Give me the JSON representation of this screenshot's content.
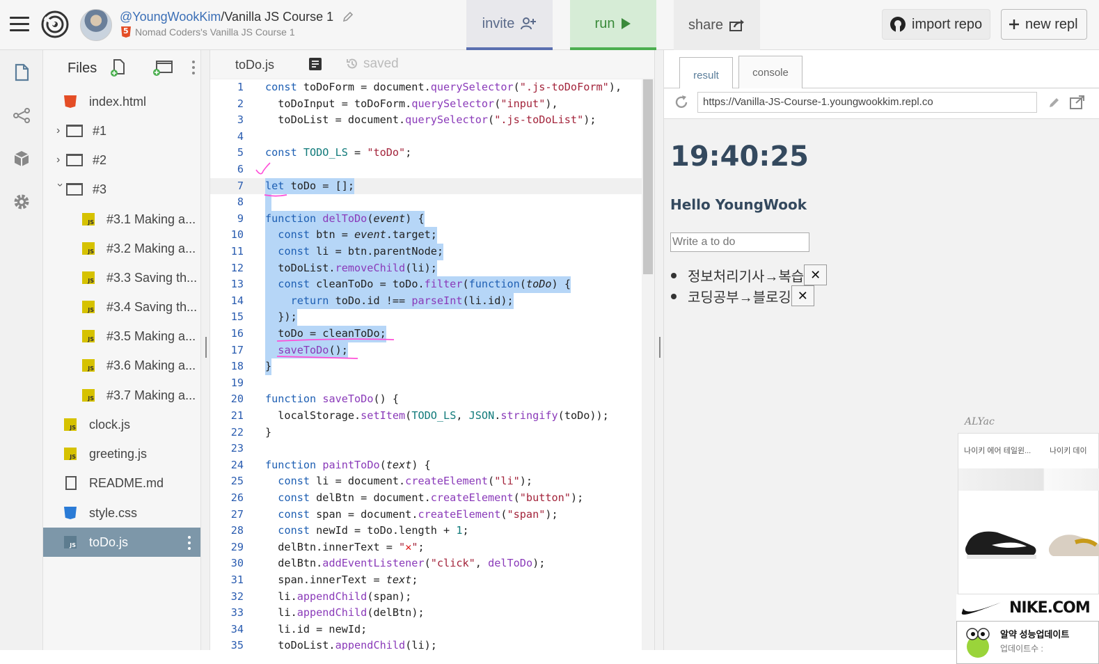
{
  "topbar": {
    "user": "@YoungWookKim",
    "separator": "/",
    "repl_name": "Vanilla JS Course 1",
    "subtitle": "Nomad Coders's Vanilla JS Course 1",
    "invite_label": "invite",
    "run_label": "run",
    "share_label": "share",
    "import_label": "import repo",
    "new_repl_label": "new repl",
    "accent_invite": "#5a6fb0",
    "accent_run": "#4caf50"
  },
  "files": {
    "title": "Files",
    "items": [
      {
        "label": "index.html",
        "icon": "html-file-icon"
      },
      {
        "label": "#1",
        "icon": "folder-icon"
      },
      {
        "label": "#2",
        "icon": "folder-icon"
      },
      {
        "label": "#3",
        "icon": "folder-icon"
      },
      {
        "label": "#3.1 Making a...",
        "icon": "js-file-icon"
      },
      {
        "label": "#3.2 Making a...",
        "icon": "js-file-icon"
      },
      {
        "label": "#3.3 Saving th...",
        "icon": "js-file-icon"
      },
      {
        "label": "#3.4 Saving th...",
        "icon": "js-file-icon"
      },
      {
        "label": "#3.5 Making a...",
        "icon": "js-file-icon"
      },
      {
        "label": "#3.6 Making a...",
        "icon": "js-file-icon"
      },
      {
        "label": "#3.7 Making a...",
        "icon": "js-file-icon"
      },
      {
        "label": "clock.js",
        "icon": "js-file-icon"
      },
      {
        "label": "greeting.js",
        "icon": "js-file-icon"
      },
      {
        "label": "README.md",
        "icon": "doc-file-icon"
      },
      {
        "label": "style.css",
        "icon": "css-file-icon"
      },
      {
        "label": "toDo.js",
        "icon": "js-file-icon",
        "selected": true
      }
    ]
  },
  "editor": {
    "tab_label": "toDo.js",
    "status": "saved",
    "lines": [
      "const toDoForm = document.querySelector(\".js-toDoForm\"),",
      "  toDoInput = toDoForm.querySelector(\"input\"),",
      "  toDoList = document.querySelector(\".js-toDoList\");",
      "",
      "const TODO_LS = \"toDo\";",
      "",
      "let toDo = [];",
      "",
      "function delToDo(event) {",
      "  const btn = event.target;",
      "  const li = btn.parentNode;",
      "  toDoList.removeChild(li);",
      "  const cleanToDo = toDo.filter(function(toDo) {",
      "    return toDo.id !== parseInt(li.id);",
      "  });",
      "  toDo = cleanToDo;",
      "  saveToDo();",
      "}",
      "",
      "function saveToDo() {",
      "  localStorage.setItem(TODO_LS, JSON.stringify(toDo));",
      "}",
      "",
      "function paintToDo(text) {",
      "  const li = document.createElement(\"li\");",
      "  const delBtn = document.createElement(\"button\");",
      "  const span = document.createElement(\"span\");",
      "  const newId = toDo.length + 1;",
      "  delBtn.innerText = \"✕\";",
      "  delBtn.addEventListener(\"click\", delToDo);",
      "  span.innerText = text;",
      "  li.appendChild(span);",
      "  li.appendChild(delBtn);",
      "  li.id = newId;",
      "  toDoList.appendChild(li);"
    ]
  },
  "output": {
    "tab_result": "result",
    "tab_console": "console",
    "url": "https://Vanilla-JS-Course-1.youngwookkim.repl.co",
    "clock": "19:40:25",
    "greeting": "Hello YoungWook",
    "todo_placeholder": "Write a to do",
    "todos": [
      "정보처리기사→복습",
      "코딩공부→블로깅"
    ],
    "delete_label": "✕"
  },
  "ad": {
    "brand_label": "ALYac",
    "product_1": "나이키 에어 테일윈...",
    "product_2": "나이키 데이",
    "nike_label": "NIKE.COM",
    "alyac_title": "알약 성능업데이트",
    "alyac_sub": "업데이트수 :"
  }
}
